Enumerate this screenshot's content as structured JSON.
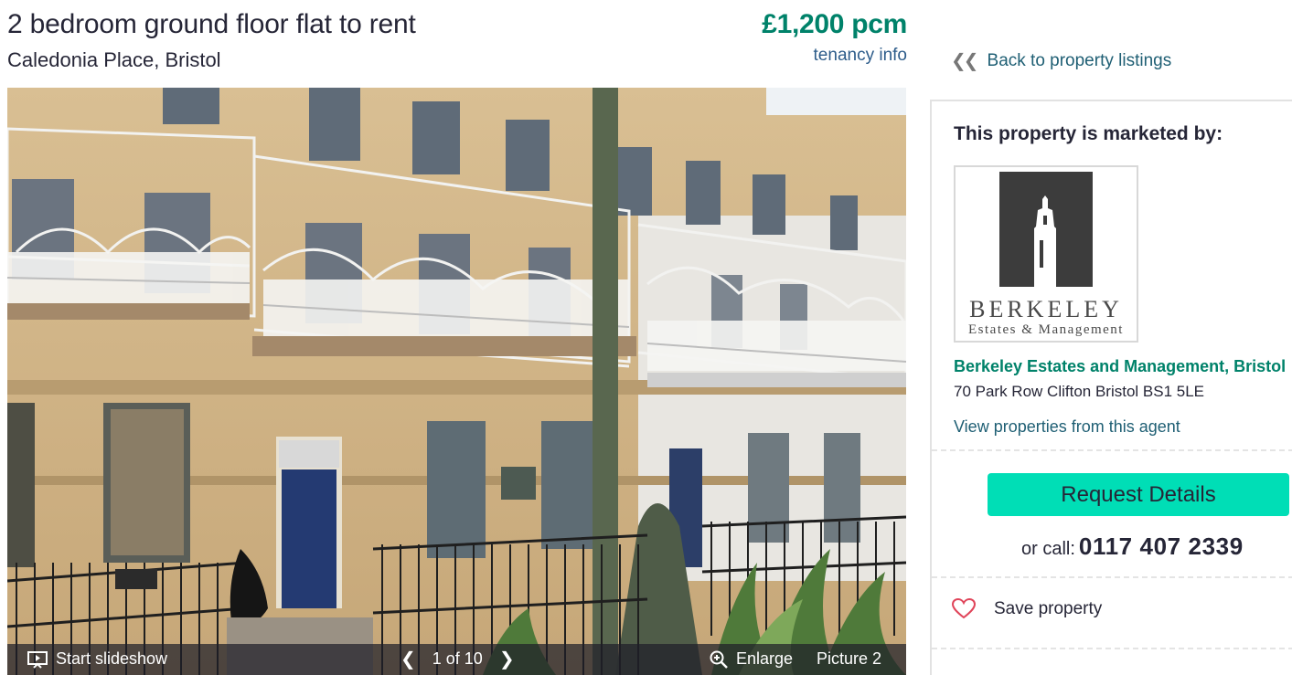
{
  "listing": {
    "title": "2 bedroom ground floor flat to rent",
    "address": "Caledonia Place, Bristol",
    "price": "£1,200 pcm",
    "tenancy_link": "tenancy info"
  },
  "gallery": {
    "slideshow_label": "Start slideshow",
    "counter": "1 of 10",
    "enlarge_label": "Enlarge",
    "picture_label": "Picture 2",
    "photo_description_icon": "building-photo"
  },
  "sidebar": {
    "back_link": "Back to property listings",
    "marketed_by": "This property is marketed by:",
    "logo": {
      "name": "BERKELEY",
      "tagline": "Estates & Management"
    },
    "agent_name": "Berkeley Estates and Management, Bristol",
    "agent_address": "70 Park Row Clifton Bristol BS1 5LE",
    "view_properties": "View properties from this agent",
    "request_button": "Request Details",
    "call_prefix": "or call:",
    "phone": "0117 407 2339",
    "save_label": "Save property"
  },
  "colors": {
    "price": "#00826a",
    "link": "#1f5f74",
    "request_button": "#00deb6",
    "heart": "#e0455a"
  }
}
